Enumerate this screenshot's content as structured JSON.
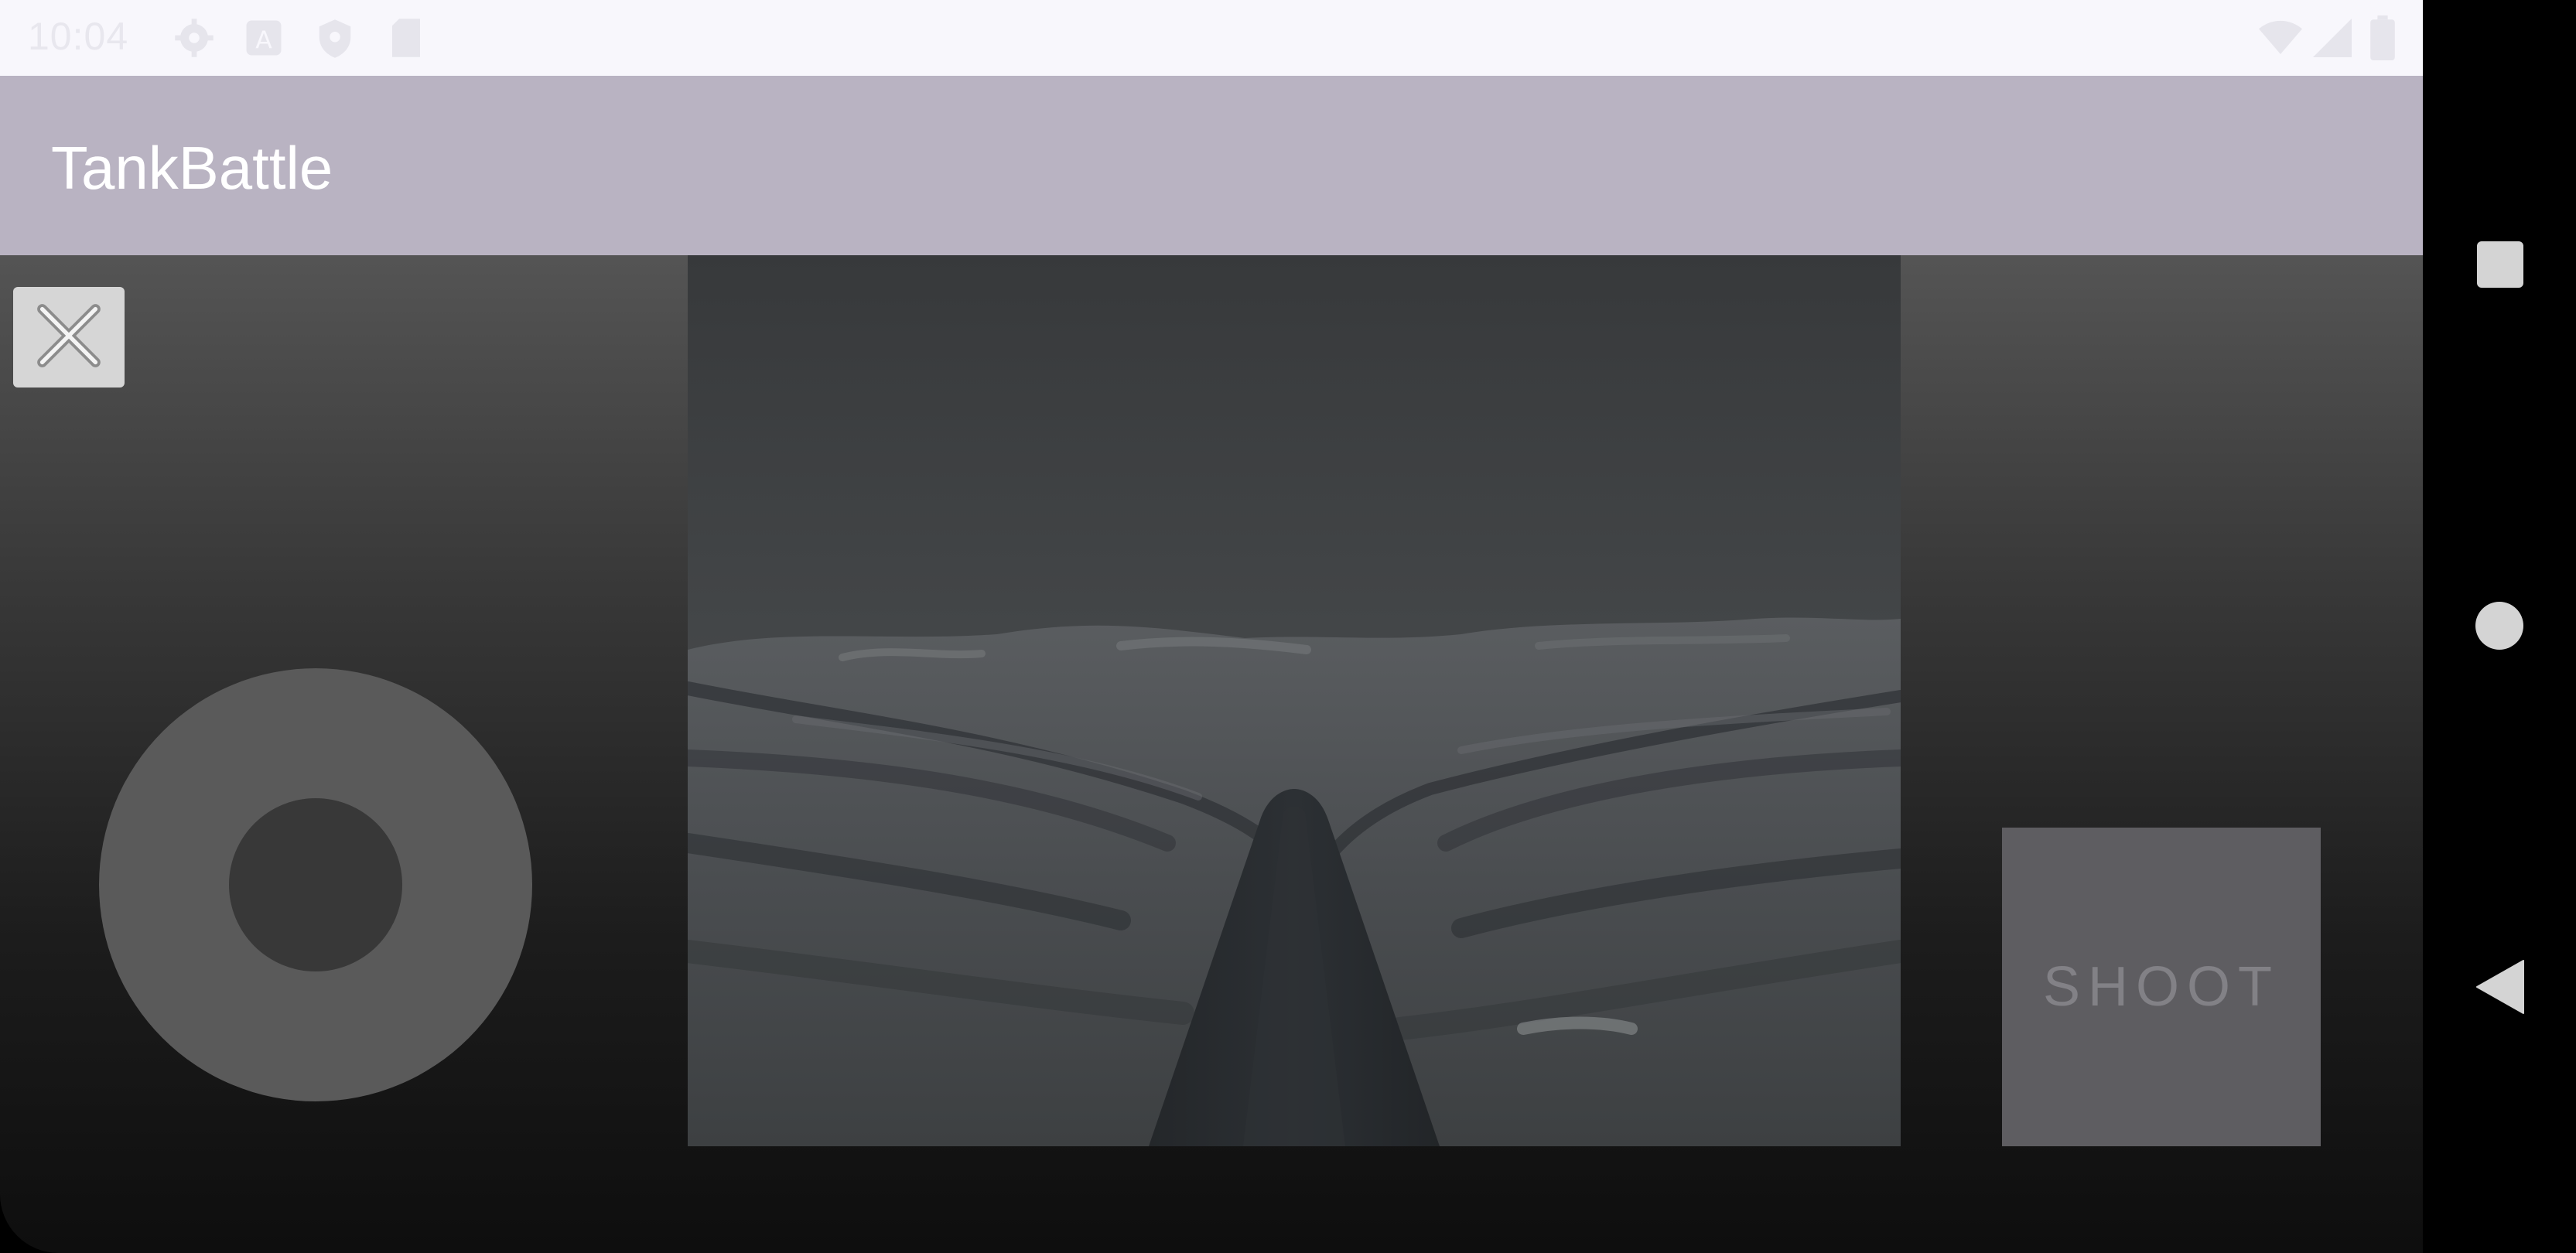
{
  "status_bar": {
    "time": "10:04",
    "icons": [
      "settings-icon",
      "a-badge-icon",
      "shield-icon",
      "sd-card-icon",
      "wifi-icon",
      "signal-icon",
      "battery-icon"
    ]
  },
  "app_bar": {
    "title": "TankBattle"
  },
  "controls": {
    "close_icon": "close-icon",
    "shoot_label": "SHOOT"
  },
  "nav_bar": {
    "icons": [
      "recents-square-icon",
      "home-circle-icon",
      "back-triangle-icon"
    ]
  },
  "colors": {
    "app_bar": "#b9b3c2",
    "status_bar": "#f8f7fc",
    "shoot_button": "#5e5d61",
    "joystick_ring": "#5a5a5a",
    "joystick_knob": "#383838"
  }
}
